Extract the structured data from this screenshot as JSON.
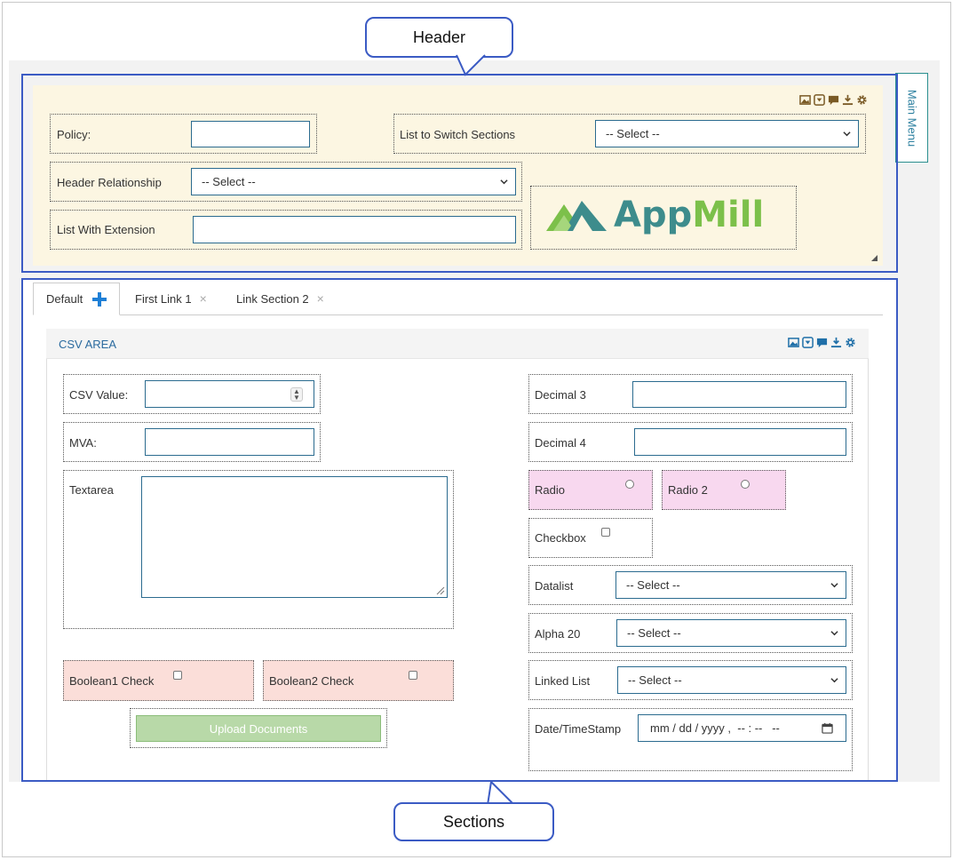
{
  "callouts": {
    "header": "Header",
    "sections": "Sections"
  },
  "main_menu": "Main Menu",
  "header": {
    "policy_label": "Policy:",
    "policy_value": "",
    "switch_sections_label": "List to Switch Sections",
    "switch_sections_value": "-- Select --",
    "relationship_label": "Header Relationship",
    "relationship_value": "-- Select --",
    "extension_label": "List With Extension",
    "extension_value": "",
    "toolbar_icons": [
      "image-icon",
      "dropdown-icon",
      "comment-icon",
      "download-icon",
      "gear-icon"
    ],
    "logo": {
      "text": "AppMill",
      "colors": {
        "app": "#3d8c8c",
        "mill": "#7cc04a"
      }
    }
  },
  "tabs": [
    {
      "label": "Default",
      "action": "+"
    },
    {
      "label": "First Link 1",
      "action": "×"
    },
    {
      "label": "Link Section 2",
      "action": "×"
    }
  ],
  "section": {
    "title": "CSV AREA",
    "toolbar_icons": [
      "image-icon",
      "dropdown-icon",
      "comment-icon",
      "download-icon",
      "gear-icon"
    ],
    "fields": {
      "csv_value": "CSV Value:",
      "mva": "MVA:",
      "textarea": "Textarea",
      "boolean1": "Boolean1 Check",
      "boolean2": "Boolean2 Check",
      "upload": "Upload Documents",
      "decimal3": "Decimal 3",
      "decimal4": "Decimal 4",
      "radio": "Radio",
      "radio2": "Radio 2",
      "checkbox": "Checkbox",
      "datalist": "Datalist",
      "datalist_value": "-- Select --",
      "alpha20": "Alpha 20",
      "alpha20_value": "-- Select --",
      "linked_list": "Linked List",
      "linked_list_value": "-- Select --",
      "datetime": "Date/TimeStamp",
      "datetime_placeholder": "mm / dd / yyyy ,  -- : --   --"
    }
  },
  "colors": {
    "accent_blue": "#3b5bc4",
    "header_bg": "#fcf6e2",
    "field_border": "#2b6b8f",
    "radio_bg": "#f8d8ef",
    "boolean_bg": "#fbded9",
    "upload_bg": "#b8d9a8"
  }
}
